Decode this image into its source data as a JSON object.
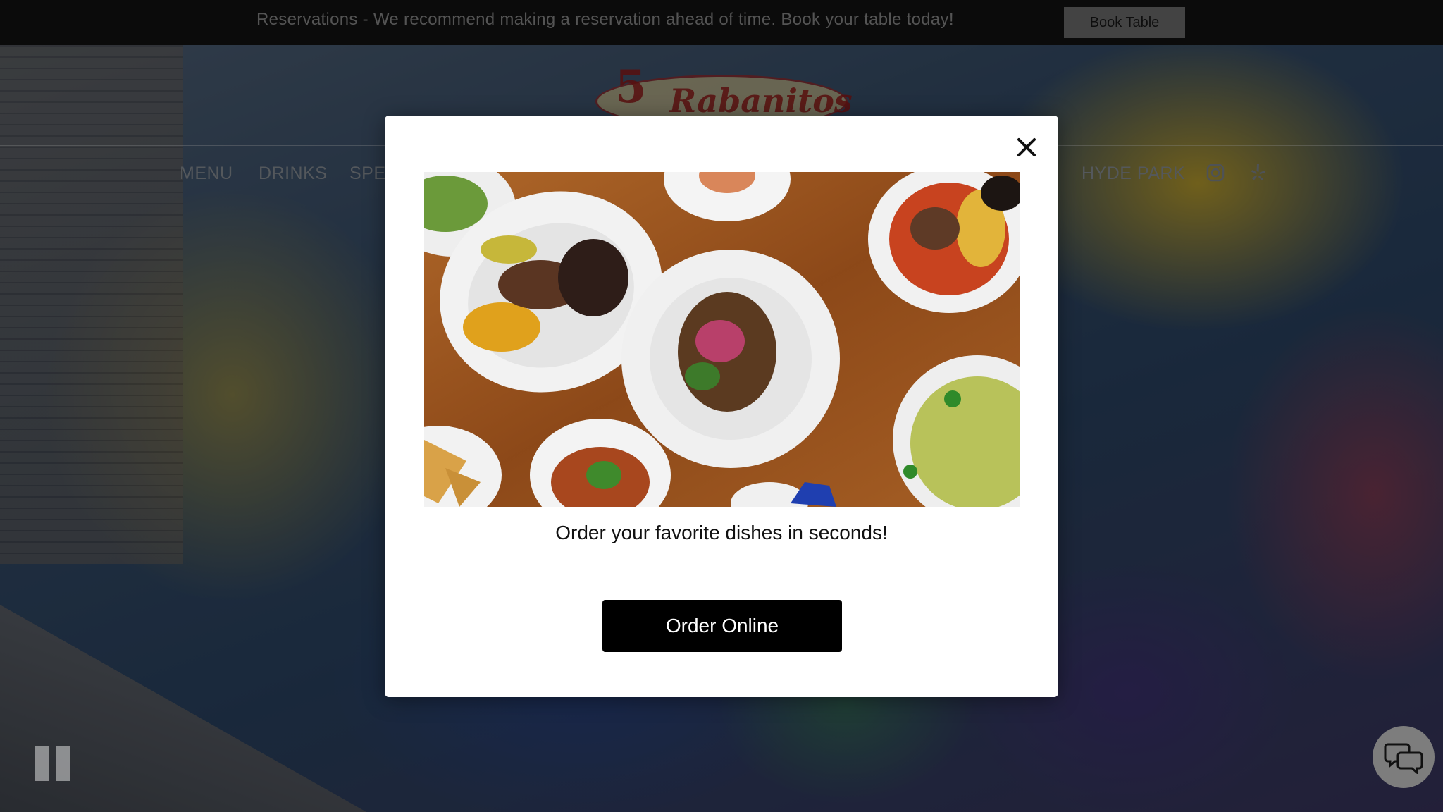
{
  "topbar": {
    "text": "Reservations - We recommend making a reservation ahead of time. Book your table today!",
    "book_button": "Book Table"
  },
  "logo": {
    "number": "5",
    "name": "Rabanitos"
  },
  "nav": {
    "items": [
      "MENU",
      "DRINKS",
      "SPE",
      "HYDE PARK"
    ],
    "social_icons": [
      "instagram-icon",
      "yelp-icon"
    ]
  },
  "modal": {
    "caption": "Order your favorite dishes in seconds!",
    "order_button": "Order Online",
    "close_icon": "close-icon"
  },
  "widgets": {
    "pause_icon": "pause-icon",
    "chat_icon": "chat-icon"
  },
  "colors": {
    "topbar_bg": "#151515",
    "book_button_bg": "#7b7b7b",
    "order_button_bg": "#000000",
    "logo_red": "#a01c1c"
  }
}
